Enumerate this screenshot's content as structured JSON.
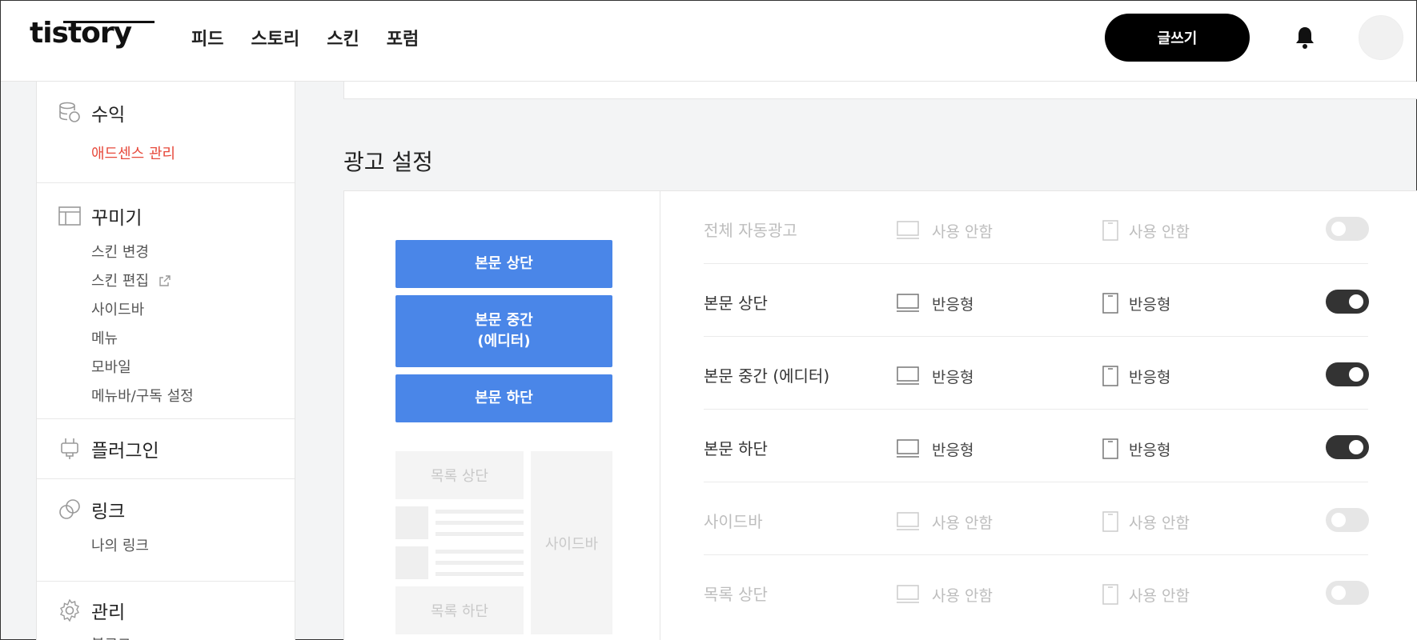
{
  "header": {
    "logo": "tistory",
    "nav": [
      "피드",
      "스토리",
      "스킨",
      "포럼"
    ],
    "write_label": "글쓰기"
  },
  "sidebar": {
    "sections": [
      {
        "title": "수익",
        "icon": "coins-icon",
        "items": [
          {
            "label": "애드센스 관리",
            "active": true
          }
        ]
      },
      {
        "title": "꾸미기",
        "icon": "layout-icon",
        "items": [
          {
            "label": "스킨 변경"
          },
          {
            "label": "스킨 편집",
            "external": true
          },
          {
            "label": "사이드바"
          },
          {
            "label": "메뉴"
          },
          {
            "label": "모바일"
          },
          {
            "label": "메뉴바/구독 설정"
          }
        ]
      },
      {
        "title": "플러그인",
        "icon": "plug-icon",
        "items": []
      },
      {
        "title": "링크",
        "icon": "link-icon",
        "items": [
          {
            "label": "나의 링크"
          }
        ]
      },
      {
        "title": "관리",
        "icon": "gear-icon",
        "items": [
          {
            "label": "블로그"
          }
        ]
      }
    ]
  },
  "main": {
    "title": "광고 설정",
    "preview": {
      "body_top": "본문 상단",
      "body_middle_line1": "본문 중간",
      "body_middle_line2": "(에디터)",
      "body_bottom": "본문 하단",
      "list_top": "목록 상단",
      "list_bottom": "목록 하단",
      "sidebar": "사이드바"
    },
    "rows": [
      {
        "name": "전체 자동광고",
        "pc": "사용 안함",
        "mobile": "사용 안함",
        "enabled": false
      },
      {
        "name": "본문 상단",
        "pc": "반응형",
        "mobile": "반응형",
        "enabled": true
      },
      {
        "name": "본문 중간 (에디터)",
        "pc": "반응형",
        "mobile": "반응형",
        "enabled": true
      },
      {
        "name": "본문 하단",
        "pc": "반응형",
        "mobile": "반응형",
        "enabled": true
      },
      {
        "name": "사이드바",
        "pc": "사용 안함",
        "mobile": "사용 안함",
        "enabled": false
      },
      {
        "name": "목록 상단",
        "pc": "사용 안함",
        "mobile": "사용 안함",
        "enabled": false
      }
    ]
  },
  "colors": {
    "accent_blue": "#4a86e8",
    "active_red": "#e7493b",
    "toggle_on": "#333333"
  }
}
